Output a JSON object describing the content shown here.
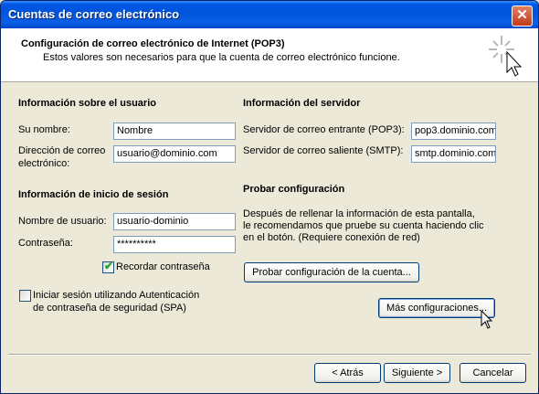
{
  "window": {
    "title": "Cuentas de correo electrónico",
    "close_glyph": "✕"
  },
  "header": {
    "title": "Configuración de correo electrónico de Internet (POP3)",
    "subtitle": "Estos valores son necesarios para que la cuenta de correo electrónico funcione.",
    "icon": "wand-sparkle-icon"
  },
  "user_info": {
    "heading": "Información sobre el usuario",
    "name_label": "Su nombre:",
    "name_value": "Nombre",
    "email_label_line1": "Dirección de correo",
    "email_label_line2": "electrónico:",
    "email_value": "usuario@dominio.com"
  },
  "login_info": {
    "heading": "Información de inicio de sesión",
    "username_label": "Nombre de usuario:",
    "username_value": "usuario-dominio",
    "password_label": "Contraseña:",
    "password_value": "**********",
    "remember_label": "Recordar contraseña",
    "remember_checked": true,
    "spa_label_line1": "Iniciar sesión utilizando Autenticación",
    "spa_label_line2": "de contraseña de seguridad (SPA)",
    "spa_checked": false
  },
  "server_info": {
    "heading": "Información del servidor",
    "incoming_label": "Servidor de correo entrante (POP3):",
    "incoming_value": "pop3.dominio.com",
    "outgoing_label": "Servidor de correo saliente (SMTP):",
    "outgoing_value": "smtp.dominio.com"
  },
  "test": {
    "heading": "Probar configuración",
    "line1": "Después de rellenar la información de esta pantalla,",
    "line2": "le recomendamos que pruebe su cuenta haciendo clic",
    "line3": "en el botón. (Requiere conexión de red)",
    "test_button": "Probar configuración de la cuenta..."
  },
  "more_settings_button": "Más configuraciones...",
  "nav": {
    "back": "< Atrás",
    "next": "Siguiente >",
    "cancel": "Cancelar"
  },
  "colors": {
    "titlebar": "#0053d9",
    "dialog_bg": "#ece9d8",
    "input_border": "#7f9db9",
    "button_border": "#003c74"
  }
}
